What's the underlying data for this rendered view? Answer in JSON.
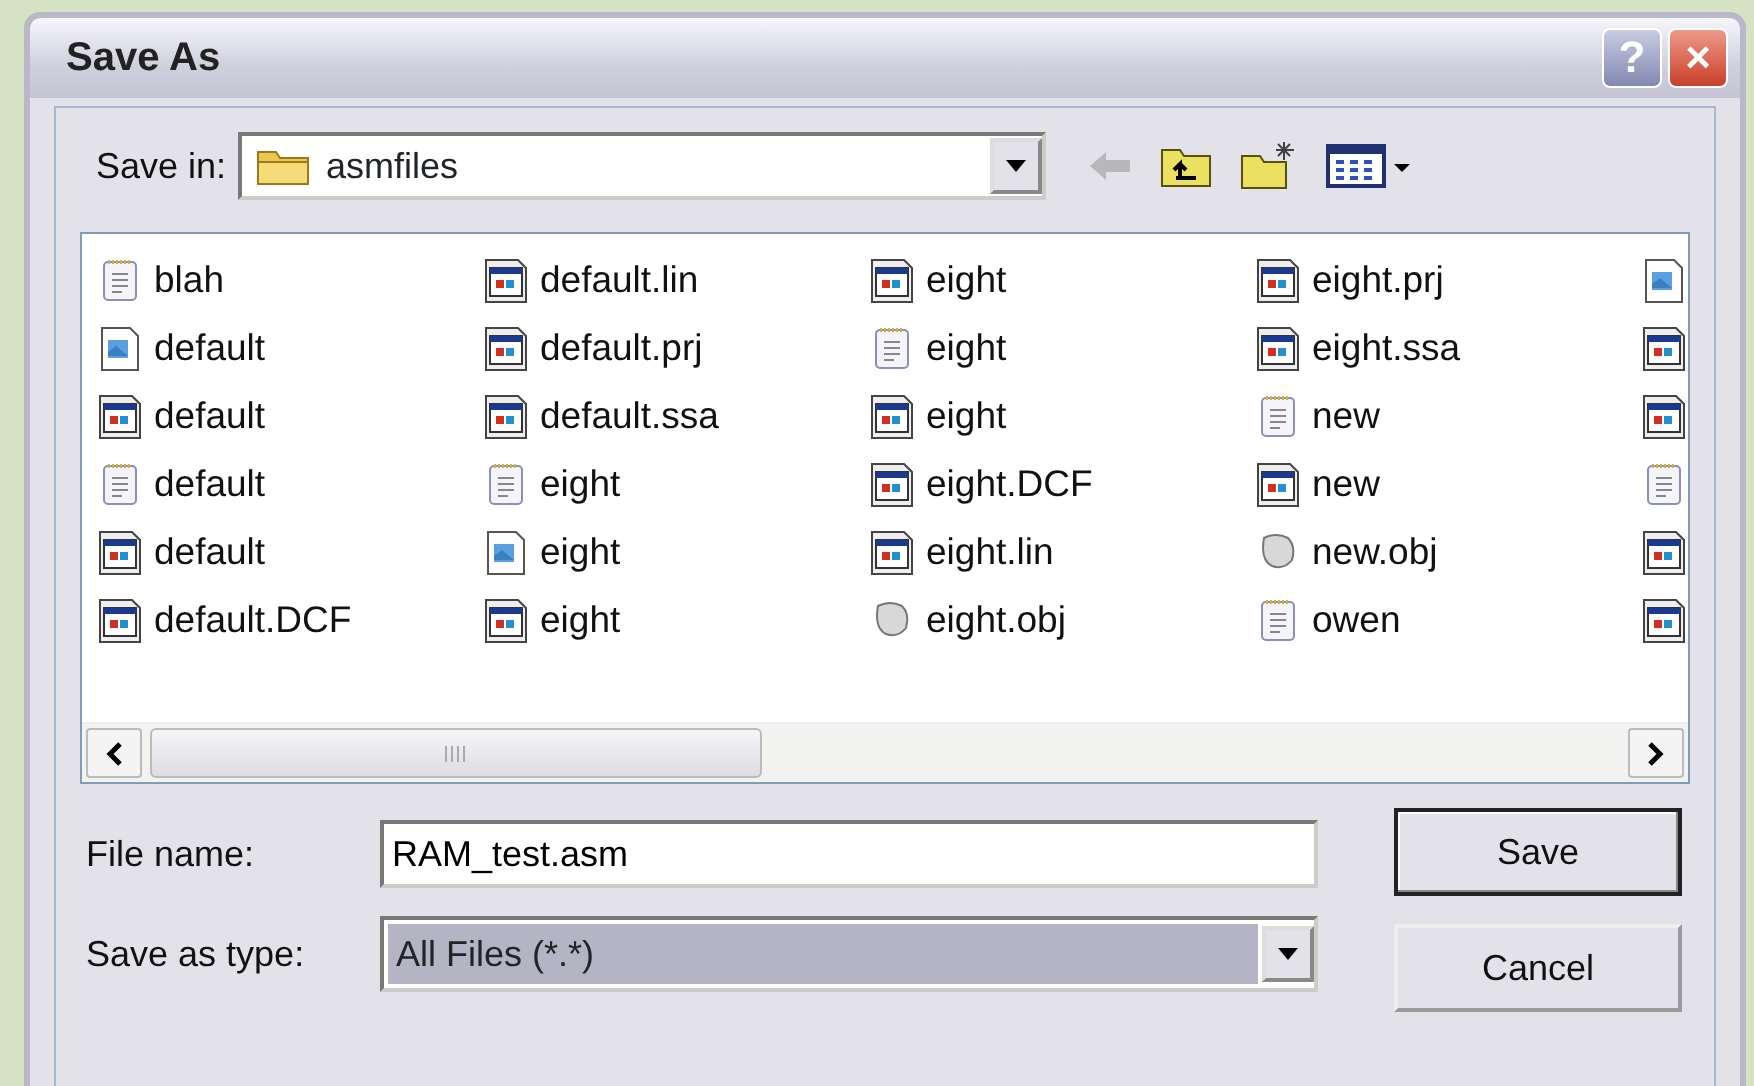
{
  "window": {
    "title": "Save As",
    "buttons": [
      "?",
      "×"
    ]
  },
  "save_in": {
    "label": "Save in:",
    "value": "asmfiles"
  },
  "files": [
    {
      "name": "blah",
      "kind": "text"
    },
    {
      "name": "default",
      "kind": "image"
    },
    {
      "name": "default",
      "kind": "app"
    },
    {
      "name": "default",
      "kind": "text"
    },
    {
      "name": "default",
      "kind": "app"
    },
    {
      "name": "default.DCF",
      "kind": "app"
    },
    {
      "name": "default.lin",
      "kind": "app"
    },
    {
      "name": "default.prj",
      "kind": "app"
    },
    {
      "name": "default.ssa",
      "kind": "app"
    },
    {
      "name": "eight",
      "kind": "text"
    },
    {
      "name": "eight",
      "kind": "image"
    },
    {
      "name": "eight",
      "kind": "app"
    },
    {
      "name": "eight",
      "kind": "app"
    },
    {
      "name": "eight",
      "kind": "text"
    },
    {
      "name": "eight",
      "kind": "app"
    },
    {
      "name": "eight.DCF",
      "kind": "app"
    },
    {
      "name": "eight.lin",
      "kind": "app"
    },
    {
      "name": "eight.obj",
      "kind": "obj"
    },
    {
      "name": "eight.prj",
      "kind": "app"
    },
    {
      "name": "eight.ssa",
      "kind": "app"
    },
    {
      "name": "new",
      "kind": "text"
    },
    {
      "name": "new",
      "kind": "app"
    },
    {
      "name": "new.obj",
      "kind": "obj"
    },
    {
      "name": "owen",
      "kind": "text"
    },
    {
      "kind": "image"
    },
    {
      "kind": "app"
    },
    {
      "kind": "app"
    },
    {
      "kind": "text"
    },
    {
      "kind": "app"
    },
    {
      "kind": "app"
    }
  ],
  "file_name": {
    "label": "File name:",
    "value": "RAM_test.asm"
  },
  "save_as_type": {
    "label": "Save as type:",
    "value": "All Files (*.*)"
  },
  "actions": [
    {
      "label": "Save",
      "default": true
    },
    {
      "label": "Cancel",
      "default": false
    }
  ]
}
